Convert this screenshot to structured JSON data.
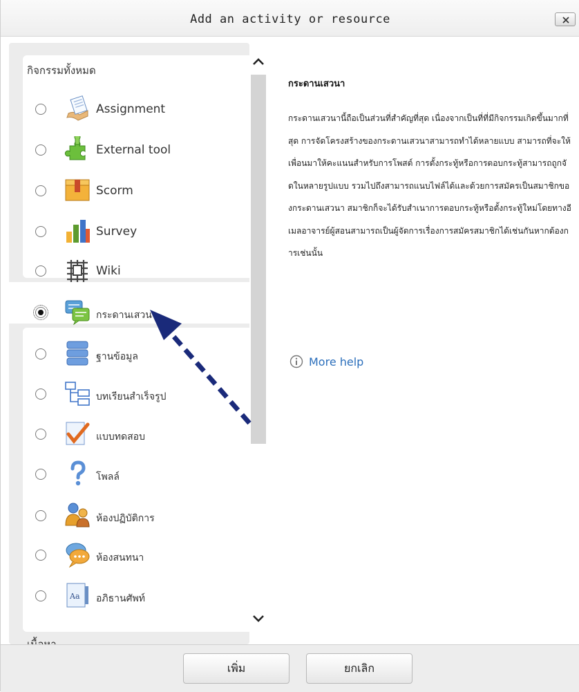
{
  "dialog": {
    "title": "Add an activity or resource",
    "close_label": "x"
  },
  "list": {
    "section_title": "กิจกรรมทั้งหมด",
    "next_section_title": "เนื้อหา",
    "items": [
      {
        "label": "Assignment",
        "icon": "assignment-icon",
        "selected": false
      },
      {
        "label": "External tool",
        "icon": "puzzle-icon",
        "selected": false
      },
      {
        "label": "Scorm",
        "icon": "package-icon",
        "selected": false
      },
      {
        "label": "Survey",
        "icon": "bar-chart-icon",
        "selected": false
      },
      {
        "label": "Wiki",
        "icon": "wiki-icon",
        "selected": false
      },
      {
        "label": "กระดานเสวนา",
        "icon": "forum-icon",
        "selected": true
      },
      {
        "label": "ฐานข้อมูล",
        "icon": "database-icon",
        "selected": false
      },
      {
        "label": "บทเรียนสำเร็จรูป",
        "icon": "lesson-icon",
        "selected": false
      },
      {
        "label": "แบบทดสอบ",
        "icon": "quiz-icon",
        "selected": false
      },
      {
        "label": "โพลล์",
        "icon": "question-icon",
        "selected": false
      },
      {
        "label": "ห้องปฏิบัติการ",
        "icon": "workshop-icon",
        "selected": false
      },
      {
        "label": "ห้องสนทนา",
        "icon": "chat-icon",
        "selected": false
      },
      {
        "label": "อภิธานศัพท์",
        "icon": "glossary-icon",
        "selected": false
      }
    ]
  },
  "description": {
    "title": "กระดานเสวนา",
    "body": "กระดานเสวนานี้ถือเป็นส่วนที่สำคัญที่สุด เนื่องจากเป็นที่ที่มีกิจกรรมเกิดขึ้นมากที่สุด การจัดโครงสร้างของกระดานเสวนาสามารถทำได้หลายแบบ สามารถที่จะให้เพื่อนมาให้คะแนนสำหรับการโพสต์ การตั้งกระทู้หรือการตอบกระทู้สามารถถูกจัดในหลายรูปแบบ รวมไปถึงสามารถแนบไฟล์ได้และด้วยการสมัครเป็นสมาชิกของกระดานเสวนา สมาชิกก็จะได้รับสำเนาการตอบกระทู้หรือตั้งกระทู้ใหม่โดยทางอีเมลอาจารย์ผู้สอนสามารถเป็นผู้จัดการเรื่องการสมัครสมาชิกได้เช่นกันหากต้องการเช่นนั้น",
    "more_help": "More help"
  },
  "footer": {
    "add_label": "เพิ่ม",
    "cancel_label": "ยกเลิก"
  },
  "colors": {
    "link": "#2a6ebb",
    "arrow": "#1a2a7a",
    "panel_bg": "#ececec"
  }
}
